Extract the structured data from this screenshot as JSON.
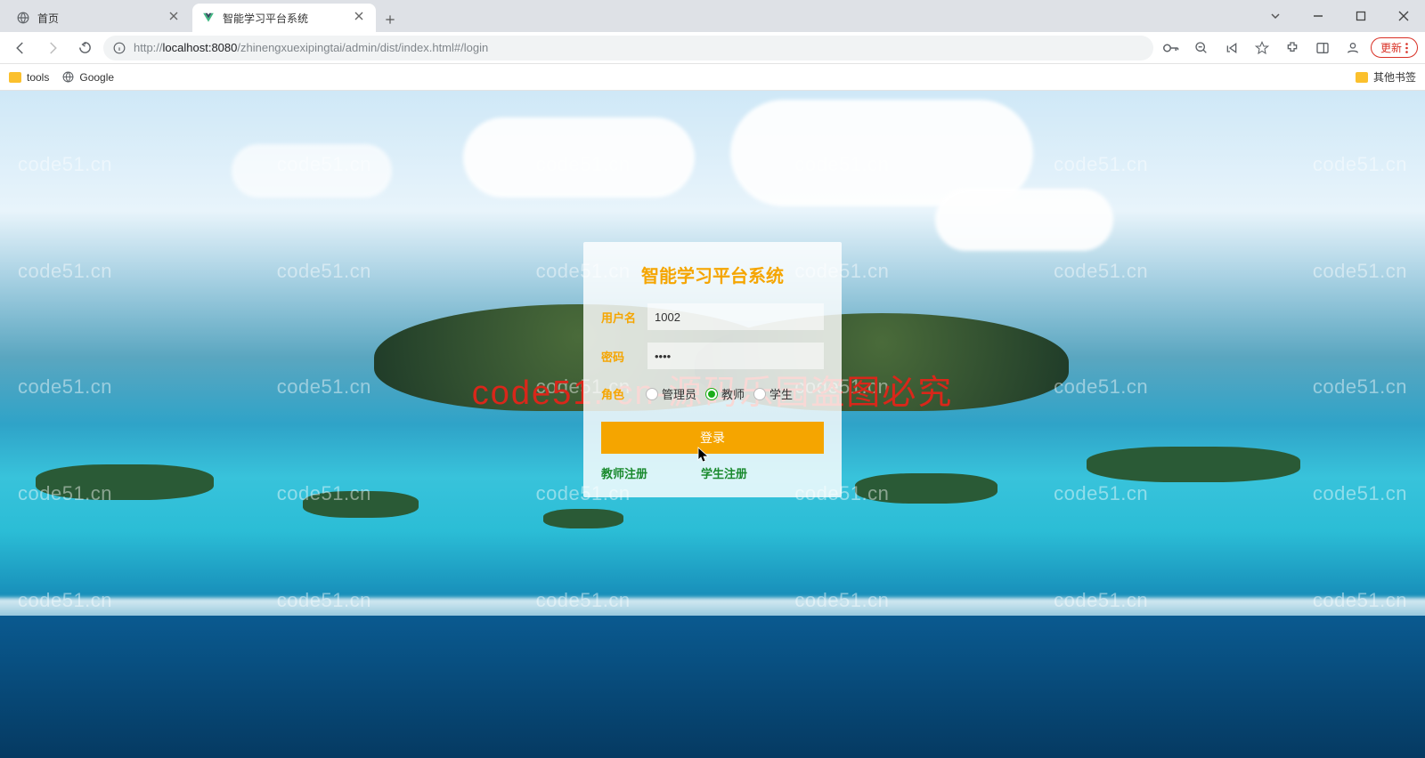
{
  "browser": {
    "tabs": [
      {
        "title": "首页",
        "active": false,
        "favicon": "globe"
      },
      {
        "title": "智能学习平台系统",
        "active": true,
        "favicon": "vue"
      }
    ],
    "url_host": "localhost:8080",
    "url_path": "/zhinengxuexipingtai/admin/dist/index.html#/login",
    "url_scheme": "http://",
    "update_label": "更新",
    "bookmarks": {
      "items": [
        {
          "label": "tools",
          "type": "folder"
        },
        {
          "label": "Google",
          "type": "globe"
        }
      ],
      "other": "其他书签"
    }
  },
  "watermark_text": "code51.cn",
  "overlay_text": "code51. cn-源码乐园盗图必究",
  "login": {
    "title": "智能学习平台系统",
    "username_label": "用户名",
    "username_value": "1002",
    "password_label": "密码",
    "password_value": "••••",
    "role_label": "角色",
    "roles": [
      {
        "label": "管理员",
        "checked": false
      },
      {
        "label": "教师",
        "checked": true
      },
      {
        "label": "学生",
        "checked": false
      }
    ],
    "submit_label": "登录",
    "register_links": [
      {
        "label": "教师注册"
      },
      {
        "label": "学生注册"
      }
    ]
  }
}
